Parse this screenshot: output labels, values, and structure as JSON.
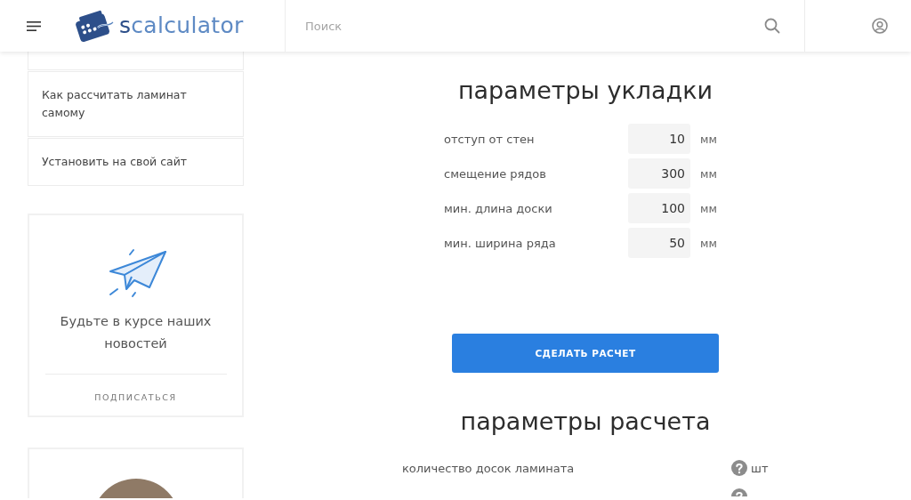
{
  "header": {
    "logo": [
      {
        "text": "s",
        "kind": "dark"
      },
      {
        "text": "calculator",
        "kind": "light"
      }
    ],
    "search": {
      "placeholder": "Поиск"
    }
  },
  "sidebar": {
    "menu_items": [
      {
        "label": "Как рассчитать ламинат самому"
      },
      {
        "label": "Установить на свой сайт"
      }
    ],
    "subscribe_card": {
      "text": "Будьте в курсе наших новостей",
      "action": "ПОДПИСАТЬСЯ"
    },
    "author_card": {
      "photo": true
    }
  },
  "main": {
    "layout_section": {
      "title": "параметры укладки",
      "fields": [
        {
          "label": "отступ от стен",
          "value": "10",
          "unit": "мм"
        },
        {
          "label": "смещение рядов",
          "value": "300",
          "unit": "мм"
        },
        {
          "label": "мин. длина доски",
          "value": "100",
          "unit": "мм"
        },
        {
          "label": "мин. ширина ряда",
          "value": "50",
          "unit": "мм"
        }
      ]
    },
    "calculate_button": "СДЕЛАТЬ РАСЧЕТ",
    "results_section": {
      "title": "параметры расчета",
      "rows": [
        {
          "label": "количество досок ламината",
          "help": true,
          "unit": "шт"
        },
        {
          "help": true
        }
      ]
    }
  }
}
